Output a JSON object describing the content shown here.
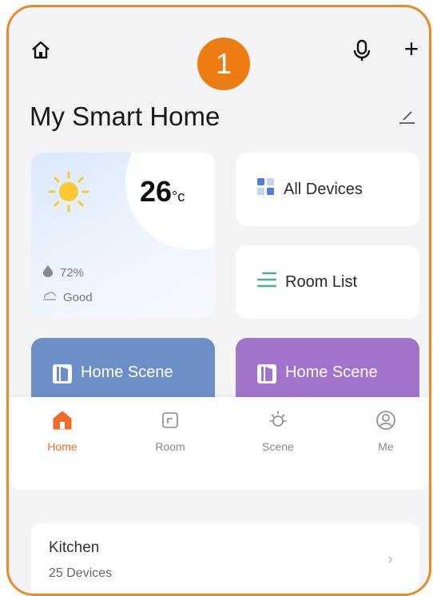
{
  "header": {
    "step_badge": "1",
    "title": "My Smart Home",
    "plus_label": "+"
  },
  "weather": {
    "temperature": "26",
    "unit": "°c",
    "humidity": "72%",
    "air_quality": "Good"
  },
  "quick_cards": {
    "all_devices": "All Devices",
    "room_list": "Room List"
  },
  "scenes": [
    {
      "label": "Home Scene"
    },
    {
      "label": "Home Scene"
    }
  ],
  "tabs": [
    {
      "label": "Home"
    },
    {
      "label": "Room"
    },
    {
      "label": "Scene"
    },
    {
      "label": "Me"
    }
  ],
  "rooms": [
    {
      "name": "Kitchen",
      "devices": "25 Devices",
      "chevron": "›"
    }
  ],
  "colors": {
    "accent_orange": "#ed7d13",
    "active_tab": "#f06a2a",
    "scene_blue": "#6d8fc7",
    "scene_purple": "#a173cb"
  }
}
